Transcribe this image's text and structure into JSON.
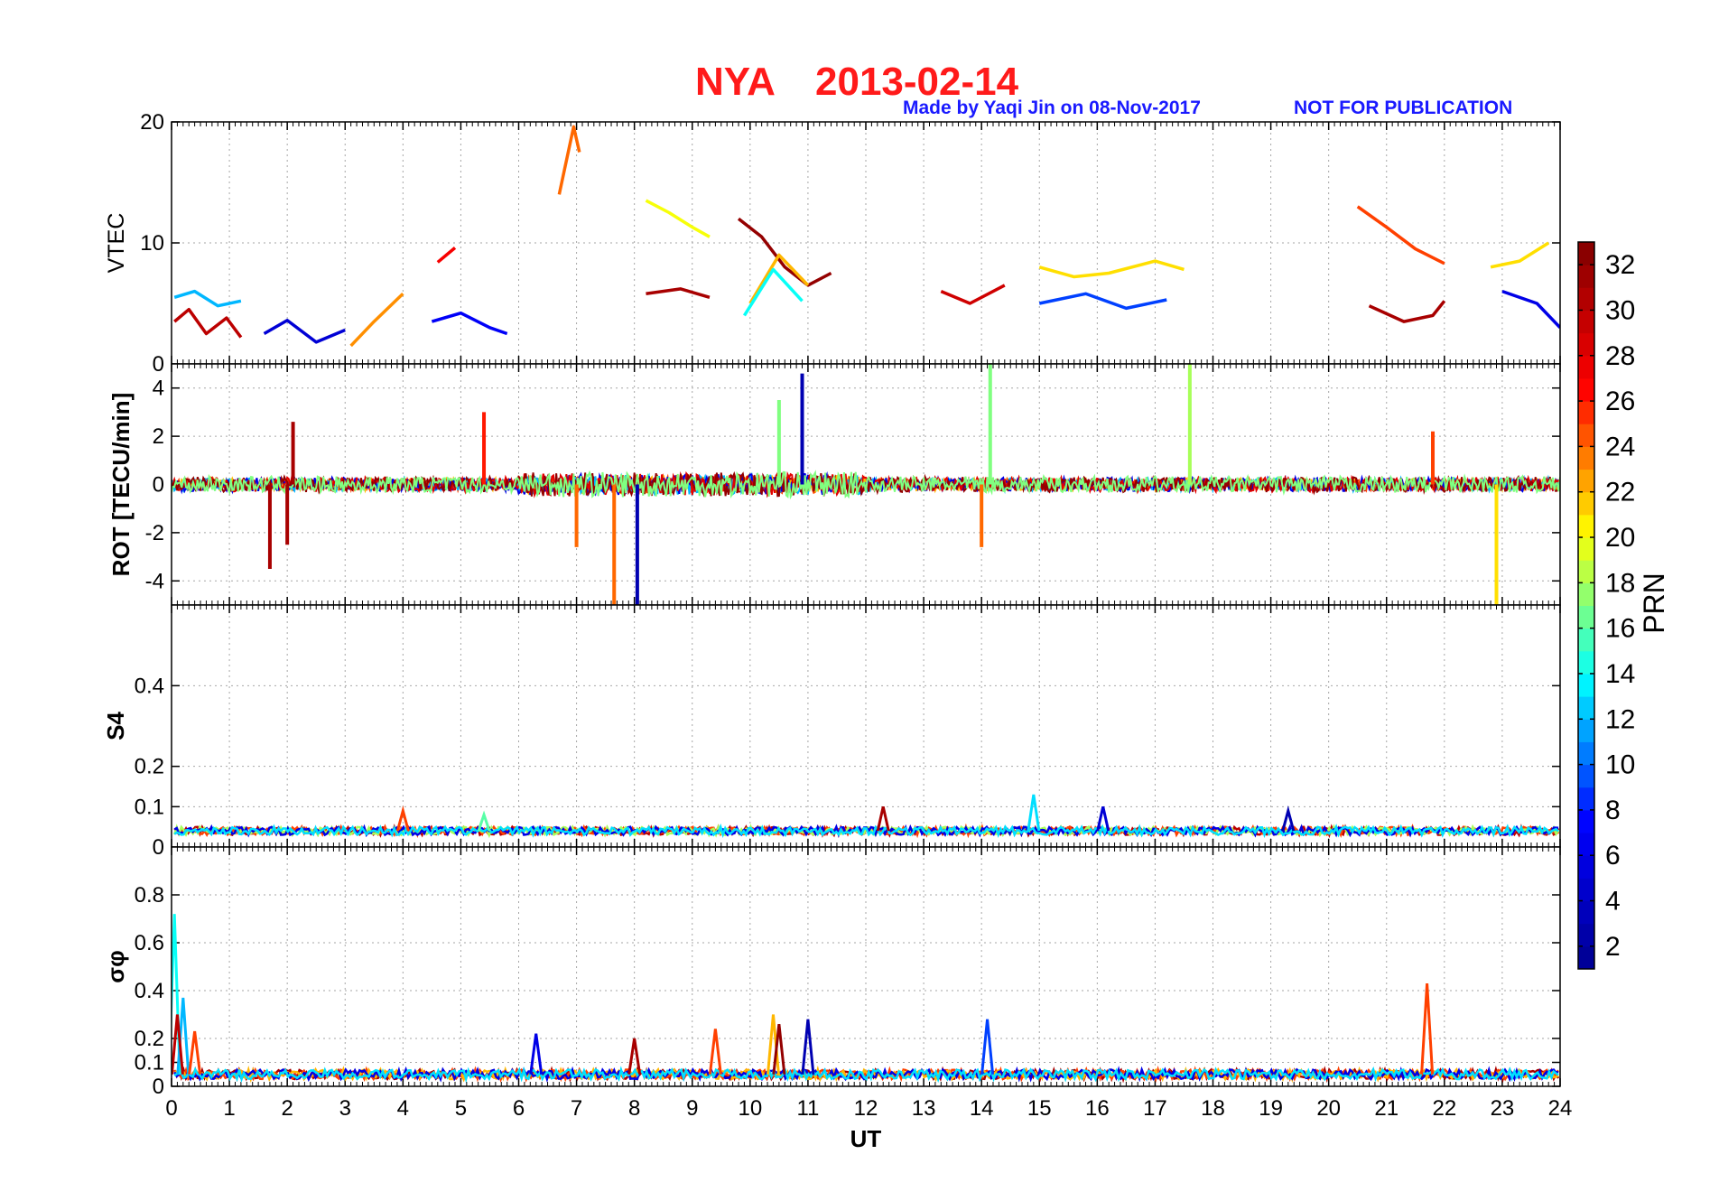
{
  "title": {
    "station": "NYA",
    "date": "2013-02-14"
  },
  "credit": {
    "made_by": "Made by Yaqi Jin on 08-Nov-2017",
    "notice": "NOT FOR PUBLICATION"
  },
  "colors": {
    "title": "#ff1a1a",
    "credit": "#1a1aff",
    "grid": "#9a9a9a",
    "axes": "#000000"
  },
  "chart_data": [
    {
      "id": "vtec",
      "type": "line",
      "ylabel": "VTEC",
      "xlim": [
        0,
        24
      ],
      "ylim": [
        0,
        20
      ],
      "yticks": [
        0,
        10,
        20
      ],
      "yticklabels": [
        "0",
        "10",
        "20"
      ],
      "grid": true,
      "series": [
        {
          "prn": 30,
          "x": [
            0.05,
            0.3,
            0.6,
            0.95,
            1.2
          ],
          "y": [
            3.5,
            4.5,
            2.5,
            3.8,
            2.2
          ]
        },
        {
          "prn": 12,
          "x": [
            0.05,
            0.4,
            0.8,
            1.2
          ],
          "y": [
            5.5,
            6.0,
            4.8,
            5.2
          ]
        },
        {
          "prn": 5,
          "x": [
            1.6,
            2.0,
            2.5,
            3.0
          ],
          "y": [
            2.5,
            3.6,
            1.8,
            2.8
          ]
        },
        {
          "prn": 23,
          "x": [
            3.1,
            3.5,
            4.0
          ],
          "y": [
            1.5,
            3.5,
            5.8
          ]
        },
        {
          "prn": 27,
          "x": [
            4.6,
            4.9
          ],
          "y": [
            8.4,
            9.6
          ]
        },
        {
          "prn": 7,
          "x": [
            4.5,
            5.0,
            5.5,
            5.8
          ],
          "y": [
            3.5,
            4.2,
            3.0,
            2.5
          ]
        },
        {
          "prn": 24,
          "x": [
            6.7,
            6.95,
            7.05
          ],
          "y": [
            14.0,
            19.6,
            17.5
          ]
        },
        {
          "prn": 20,
          "x": [
            8.2,
            8.6,
            9.0,
            9.3
          ],
          "y": [
            13.5,
            12.5,
            11.3,
            10.5
          ]
        },
        {
          "prn": 31,
          "x": [
            8.2,
            8.8,
            9.3
          ],
          "y": [
            5.8,
            6.2,
            5.5
          ]
        },
        {
          "prn": 32,
          "x": [
            9.8,
            10.2,
            10.6,
            11.0,
            11.4
          ],
          "y": [
            12.0,
            10.5,
            8.0,
            6.5,
            7.5
          ]
        },
        {
          "prn": 22,
          "x": [
            10.0,
            10.5,
            11.0
          ],
          "y": [
            5.0,
            9.0,
            6.5
          ]
        },
        {
          "prn": 14,
          "x": [
            9.9,
            10.4,
            10.9
          ],
          "y": [
            4.0,
            7.8,
            5.2
          ]
        },
        {
          "prn": 29,
          "x": [
            13.3,
            13.8,
            14.4
          ],
          "y": [
            6.0,
            5.0,
            6.5
          ]
        },
        {
          "prn": 21,
          "x": [
            15.0,
            15.6,
            16.2,
            17.0,
            17.5
          ],
          "y": [
            8.0,
            7.2,
            7.5,
            8.5,
            7.8
          ]
        },
        {
          "prn": 9,
          "x": [
            15.0,
            15.8,
            16.5,
            17.2
          ],
          "y": [
            5.0,
            5.8,
            4.6,
            5.3
          ]
        },
        {
          "prn": 25,
          "x": [
            20.5,
            21.0,
            21.5,
            22.0
          ],
          "y": [
            13.0,
            11.3,
            9.5,
            8.3
          ]
        },
        {
          "prn": 31,
          "x": [
            20.7,
            21.3,
            21.8,
            22.0
          ],
          "y": [
            4.8,
            3.5,
            4.0,
            5.2
          ]
        },
        {
          "prn": 21,
          "x": [
            22.8,
            23.3,
            23.8
          ],
          "y": [
            8.0,
            8.5,
            10.0
          ]
        },
        {
          "prn": 6,
          "x": [
            23.0,
            23.6,
            24.0
          ],
          "y": [
            6.0,
            5.0,
            3.0
          ]
        }
      ]
    },
    {
      "id": "rot",
      "type": "line",
      "ylabel": "ROT [TECU/min]",
      "xlim": [
        0,
        24
      ],
      "ylim": [
        -5,
        5
      ],
      "yticks": [
        -4,
        -2,
        0,
        2,
        4
      ],
      "yticklabels": [
        "-4",
        "-2",
        "0",
        "2",
        "4"
      ],
      "grid": true,
      "spikes": [
        {
          "x": 1.7,
          "y": -3.5,
          "prn": 31
        },
        {
          "x": 2.0,
          "y": -2.5,
          "prn": 31
        },
        {
          "x": 2.1,
          "y": 2.6,
          "prn": 31
        },
        {
          "x": 5.4,
          "y": 3.0,
          "prn": 26
        },
        {
          "x": 7.0,
          "y": -2.6,
          "prn": 24
        },
        {
          "x": 7.65,
          "y": -5.0,
          "prn": 24
        },
        {
          "x": 8.05,
          "y": -5.0,
          "prn": 3
        },
        {
          "x": 10.5,
          "y": 3.5,
          "prn": 17
        },
        {
          "x": 10.9,
          "y": 4.6,
          "prn": 3
        },
        {
          "x": 14.0,
          "y": -2.6,
          "prn": 24
        },
        {
          "x": 14.15,
          "y": 5.0,
          "prn": 17
        },
        {
          "x": 17.6,
          "y": 5.0,
          "prn": 18
        },
        {
          "x": 22.9,
          "y": -5.0,
          "prn": 21
        },
        {
          "x": 21.8,
          "y": 2.2,
          "prn": 25
        }
      ]
    },
    {
      "id": "s4",
      "type": "line",
      "ylabel": "S4",
      "xlim": [
        0,
        24
      ],
      "ylim": [
        0,
        0.6
      ],
      "yticks": [
        0,
        0.1,
        0.2,
        0.4
      ],
      "yticklabels": [
        "0",
        "0.1",
        "0.2",
        "0.4"
      ],
      "grid": true,
      "baseline": 0.04,
      "peaks": [
        {
          "x": 4.0,
          "y": 0.09,
          "prn": 25
        },
        {
          "x": 5.4,
          "y": 0.08,
          "prn": 16
        },
        {
          "x": 12.3,
          "y": 0.1,
          "prn": 31
        },
        {
          "x": 14.9,
          "y": 0.13,
          "prn": 13
        },
        {
          "x": 16.1,
          "y": 0.1,
          "prn": 5
        },
        {
          "x": 19.3,
          "y": 0.09,
          "prn": 3
        }
      ]
    },
    {
      "id": "sigma_phi",
      "type": "line",
      "ylabel": "σφ",
      "xlim": [
        0,
        24
      ],
      "ylim": [
        0,
        1
      ],
      "yticks": [
        0,
        0.1,
        0.2,
        0.4,
        0.6,
        0.8
      ],
      "yticklabels": [
        "0",
        "0.1",
        "0.2",
        "0.4",
        "0.6",
        "0.8"
      ],
      "grid": true,
      "baseline": 0.05,
      "peaks": [
        {
          "x": 0.05,
          "y": 0.72,
          "prn": 14
        },
        {
          "x": 0.2,
          "y": 0.37,
          "prn": 12
        },
        {
          "x": 0.1,
          "y": 0.3,
          "prn": 30
        },
        {
          "x": 0.4,
          "y": 0.23,
          "prn": 25
        },
        {
          "x": 6.3,
          "y": 0.22,
          "prn": 6
        },
        {
          "x": 8.0,
          "y": 0.2,
          "prn": 31
        },
        {
          "x": 9.4,
          "y": 0.24,
          "prn": 25
        },
        {
          "x": 10.4,
          "y": 0.3,
          "prn": 22
        },
        {
          "x": 10.5,
          "y": 0.26,
          "prn": 32
        },
        {
          "x": 11.0,
          "y": 0.28,
          "prn": 3
        },
        {
          "x": 14.1,
          "y": 0.28,
          "prn": 9
        },
        {
          "x": 21.7,
          "y": 0.43,
          "prn": 25
        }
      ]
    }
  ],
  "xaxis": {
    "label": "UT",
    "ticks": [
      "0",
      "1",
      "2",
      "3",
      "4",
      "5",
      "6",
      "7",
      "8",
      "9",
      "10",
      "11",
      "12",
      "13",
      "14",
      "15",
      "16",
      "17",
      "18",
      "19",
      "20",
      "21",
      "22",
      "23",
      "24"
    ]
  },
  "colorbar": {
    "label": "PRN",
    "range": [
      1,
      33
    ],
    "ticks": [
      "2",
      "4",
      "6",
      "8",
      "10",
      "12",
      "14",
      "16",
      "18",
      "20",
      "22",
      "24",
      "26",
      "28",
      "30",
      "32"
    ],
    "colormap": [
      "#00008f",
      "#0000ff",
      "#00ffff",
      "#ffff00",
      "#ff0000",
      "#800000"
    ]
  }
}
